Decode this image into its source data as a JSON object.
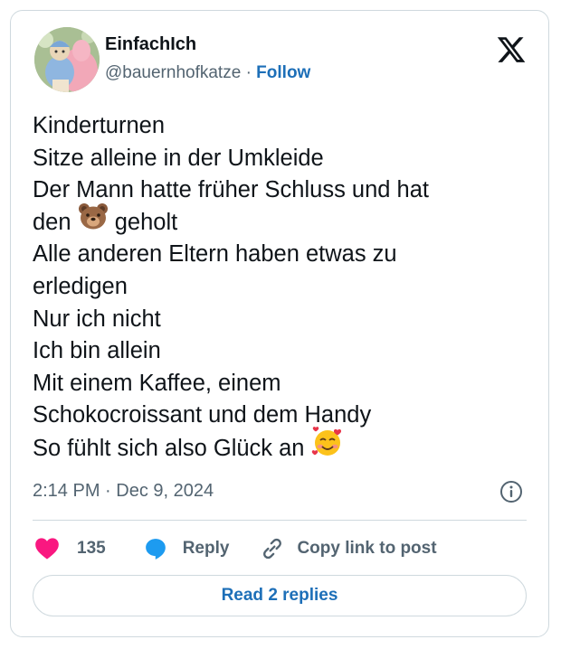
{
  "author": {
    "display_name": "EinfachIch",
    "handle": "@bauernhofkatze",
    "separator": "·",
    "follow_label": "Follow"
  },
  "tweet": {
    "lines": [
      "Kinderturnen",
      "Sitze alleine in der Umkleide",
      "Der Mann hatte früher Schluss und hat",
      "den",
      "geholt",
      "Alle anderen Eltern haben etwas zu",
      "erledigen",
      "Nur ich nicht",
      "Ich bin allein",
      "Mit einem Kaffee, einem",
      "Schokocroissant und dem Handy",
      "So fühlt sich also Glück an"
    ],
    "emojis": [
      "bear-face-emoji",
      "smiling-face-with-hearts-emoji"
    ]
  },
  "meta": {
    "time": "2:14 PM",
    "separator": "·",
    "date": "Dec 9, 2024"
  },
  "actions": {
    "like_count": "135",
    "reply_label": "Reply",
    "copy_label": "Copy link to post"
  },
  "read_replies_label": "Read 2 replies",
  "colors": {
    "accent": "#1d6fb8",
    "like": "#f91880",
    "reply_icon": "#1d9bf0",
    "text": "#0f1419",
    "muted": "#536471",
    "border": "#cfd9de"
  },
  "icons": [
    "x-logo-icon",
    "info-icon",
    "heart-icon",
    "reply-bubble-icon",
    "link-icon"
  ]
}
